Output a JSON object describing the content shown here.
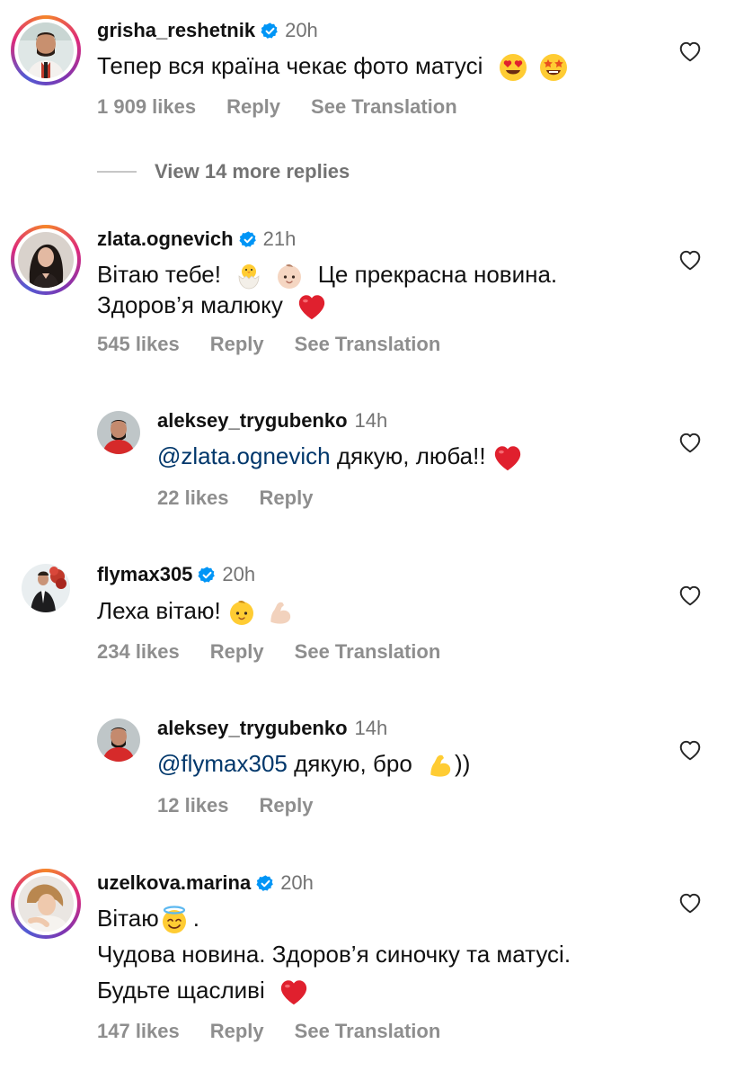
{
  "comments": [
    {
      "username": "grisha_reshetnik",
      "time": "20h",
      "text": "Тепер вся країна чекає фото матусі",
      "emojis": [
        "heart-eyes-emoji",
        "star-struck-emoji"
      ],
      "likes": "1 909 likes",
      "reply": "Reply",
      "translate": "See Translation"
    },
    {
      "username": "zlata.ognevich",
      "time": "21h",
      "text_line1": "Вітаю тебе!",
      "text_line1b": "Це прекрасна новина.",
      "text_line2": "Здоров’я малюку",
      "likes": "545 likes",
      "reply": "Reply",
      "translate": "See Translation"
    },
    {
      "username": "aleksey_trygubenko",
      "time": "14h",
      "mention": "@zlata.ognevich",
      "text": " дякую, люба!!",
      "likes": "22 likes",
      "reply": "Reply"
    },
    {
      "username": "flymax305",
      "time": "20h",
      "text": "Леха вітаю!",
      "likes": "234 likes",
      "reply": "Reply",
      "translate": "See Translation"
    },
    {
      "username": "aleksey_trygubenko",
      "time": "14h",
      "mention": "@flymax305",
      "text": " дякую, бро",
      "text_after": "))",
      "likes": "12 likes",
      "reply": "Reply"
    },
    {
      "username": "uzelkova.marina",
      "time": "20h",
      "text_line1": "Вітаю",
      "text_line1b": ".",
      "text_line2": "Чудова новина. Здоров’я синочку та матусі.",
      "text_line3": "Будьте щасливі",
      "likes": "147 likes",
      "reply": "Reply",
      "translate": "See Translation"
    }
  ],
  "view_more_replies": "View 14 more replies",
  "colors": {
    "verified": "#0095f6",
    "mention": "#00376b",
    "secondary_text": "#8e8e8e",
    "heart_red": "#e0202e"
  }
}
